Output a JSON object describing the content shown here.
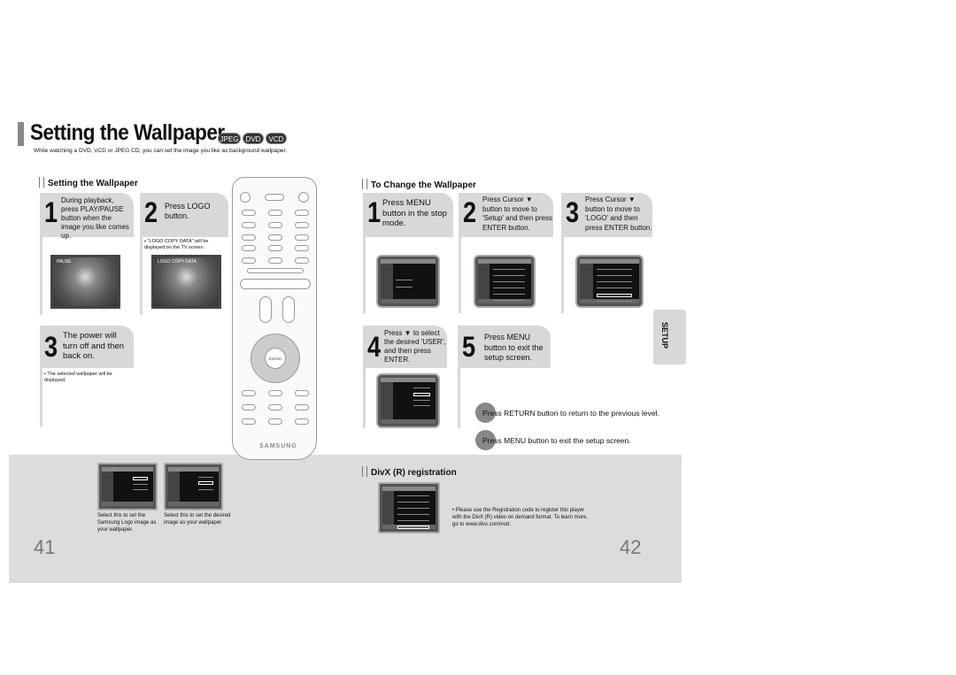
{
  "title": "Setting the Wallpaper",
  "badges": [
    "JPEG",
    "DVD",
    "VCD"
  ],
  "subtitle": "While watching a DVD, VCD or JPEG CD, you can set the image you like as background wallpaper.",
  "left": {
    "heading": "Setting the Wallpaper",
    "steps": [
      {
        "num": "1",
        "text": "During playback, press PLAY/PAUSE button when the image you like comes up.",
        "photo_label": "PAUSE"
      },
      {
        "num": "2",
        "text": "Press LOGO button.",
        "note": "• \"LOGO COPY DATA\" will be displayed on the TV screen.",
        "photo_label": "LOGO COPY DATA"
      },
      {
        "num": "3",
        "text": "The power will turn off and then back on.",
        "note": "• The selected wallpaper will be displayed."
      }
    ],
    "captions": [
      "Select this to set the Samsung Logo image as your wallpaper.",
      "Select this to set the desired image as your wallpaper."
    ]
  },
  "right": {
    "heading": "To Change the Wallpaper",
    "steps": [
      {
        "num": "1",
        "text": "Press MENU button in the stop mode."
      },
      {
        "num": "2",
        "text": "Press Cursor ▼ button to move to 'Setup' and then press ENTER button."
      },
      {
        "num": "3",
        "text": "Press Cursor ▼ button to move to 'LOGO' and then press ENTER button."
      },
      {
        "num": "4",
        "text": "Press ▼ to select the desired 'USER', and then press ENTER."
      },
      {
        "num": "5",
        "text": "Press MENU button to exit the setup screen."
      }
    ],
    "tips": [
      "Press RETURN button to return to the previous level.",
      "Press MENU button to exit the setup screen."
    ],
    "divx_heading": "DivX (R) registration",
    "divx_note": "• Please use the Registration code to register this player with the DivX (R) video on demand format. To learn more, go to www.divx.com/vod."
  },
  "remote": {
    "brand": "SAMSUNG",
    "enter": "ENTER"
  },
  "side_tab": "SETUP",
  "page_numbers": [
    "41",
    "42"
  ]
}
